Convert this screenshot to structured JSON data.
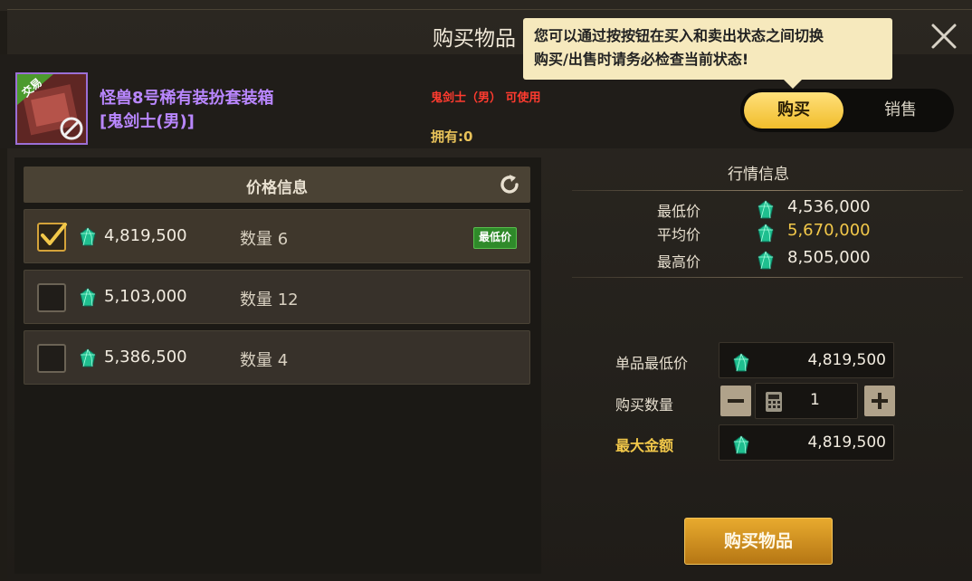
{
  "window": {
    "title": "购买物品"
  },
  "tooltip": {
    "line1": "您可以通过按按钮在买入和卖出状态之间切换",
    "line2": "购买/出售时请务必检查当前状态!"
  },
  "item": {
    "name_line1": "怪兽8号稀有装扮套装箱",
    "name_line2": "[鬼剑士(男)]",
    "class_requirement": "鬼剑士（男） 可使用",
    "owned": "拥有:0",
    "icon_badge": "交易"
  },
  "mode_toggle": {
    "buy_label": "购买",
    "sell_label": "销售",
    "active": "buy"
  },
  "price_list": {
    "header": "价格信息",
    "rows": [
      {
        "price": "4,819,500",
        "qty_text": "数量 6",
        "badge": "最低价",
        "checked": true
      },
      {
        "price": "5,103,000",
        "qty_text": "数量 12",
        "badge": "",
        "checked": false
      },
      {
        "price": "5,386,500",
        "qty_text": "数量 4",
        "badge": "",
        "checked": false
      }
    ]
  },
  "market": {
    "title": "行情信息",
    "lowest_label": "最低价",
    "lowest_value": "4,536,000",
    "average_label": "平均价",
    "average_value": "5,670,000",
    "highest_label": "最高价",
    "highest_value": "8,505,000"
  },
  "form": {
    "unit_min_label": "单品最低价",
    "unit_min_value": "4,819,500",
    "buy_qty_label": "购买数量",
    "buy_qty_value": "1",
    "max_amount_label": "最大金额",
    "max_amount_value": "4,819,500"
  },
  "buy_button_label": "购买物品",
  "colors": {
    "gold": "#f2c84a",
    "accent_button": "#e8aa2e",
    "lowest_badge": "#2f8a2a",
    "rare_purple": "#b987ff"
  },
  "icons": [
    "close-icon",
    "refresh-icon",
    "gem-icon",
    "checkmark-icon",
    "calculator-icon",
    "minus-icon",
    "plus-icon"
  ]
}
